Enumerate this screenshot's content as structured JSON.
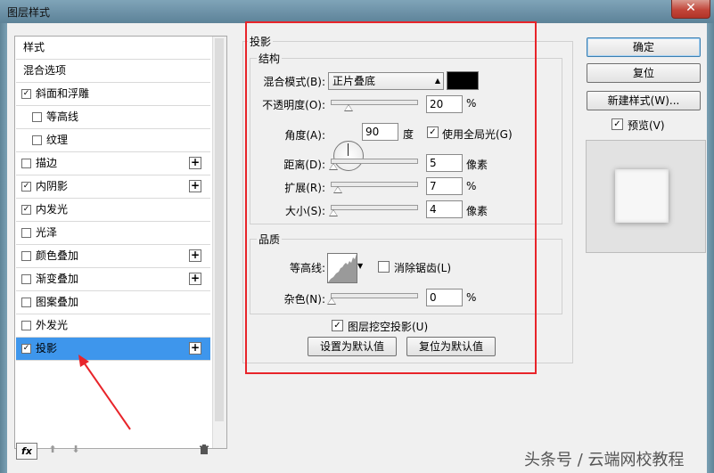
{
  "window": {
    "title": "图层样式",
    "close_glyph": "✕"
  },
  "left_panel": {
    "items": [
      {
        "label": "样式",
        "has_checkbox": false,
        "checked": false,
        "indent": false,
        "has_plus": false,
        "selected": false
      },
      {
        "label": "混合选项",
        "has_checkbox": false,
        "checked": false,
        "indent": false,
        "has_plus": false,
        "selected": false
      },
      {
        "label": "斜面和浮雕",
        "has_checkbox": true,
        "checked": true,
        "indent": false,
        "has_plus": false,
        "selected": false
      },
      {
        "label": "等高线",
        "has_checkbox": true,
        "checked": false,
        "indent": true,
        "has_plus": false,
        "selected": false
      },
      {
        "label": "纹理",
        "has_checkbox": true,
        "checked": false,
        "indent": true,
        "has_plus": false,
        "selected": false
      },
      {
        "label": "描边",
        "has_checkbox": true,
        "checked": false,
        "indent": false,
        "has_plus": true,
        "selected": false
      },
      {
        "label": "内阴影",
        "has_checkbox": true,
        "checked": true,
        "indent": false,
        "has_plus": true,
        "selected": false
      },
      {
        "label": "内发光",
        "has_checkbox": true,
        "checked": true,
        "indent": false,
        "has_plus": false,
        "selected": false
      },
      {
        "label": "光泽",
        "has_checkbox": true,
        "checked": false,
        "indent": false,
        "has_plus": false,
        "selected": false
      },
      {
        "label": "颜色叠加",
        "has_checkbox": true,
        "checked": false,
        "indent": false,
        "has_plus": true,
        "selected": false
      },
      {
        "label": "渐变叠加",
        "has_checkbox": true,
        "checked": false,
        "indent": false,
        "has_plus": true,
        "selected": false
      },
      {
        "label": "图案叠加",
        "has_checkbox": true,
        "checked": false,
        "indent": false,
        "has_plus": false,
        "selected": false
      },
      {
        "label": "外发光",
        "has_checkbox": true,
        "checked": false,
        "indent": false,
        "has_plus": false,
        "selected": false
      },
      {
        "label": "投影",
        "has_checkbox": true,
        "checked": true,
        "indent": false,
        "has_plus": true,
        "selected": true
      }
    ],
    "fx_label": "fx",
    "up_glyph": "⬆",
    "down_glyph": "⬇",
    "trash_glyph": "🗑"
  },
  "drop_shadow": {
    "section_title": "投影",
    "structure": {
      "title": "结构",
      "blend_mode_label": "混合模式(B):",
      "blend_mode_value": "正片叠底",
      "blend_color": "#000000",
      "opacity_label": "不透明度(O):",
      "opacity_value": "20",
      "opacity_unit": "%",
      "angle_label": "角度(A):",
      "angle_value": "90",
      "angle_unit": "度",
      "global_light_label": "使用全局光(G)",
      "global_light_checked": true,
      "distance_label": "距离(D):",
      "distance_value": "5",
      "distance_unit": "像素",
      "spread_label": "扩展(R):",
      "spread_value": "7",
      "spread_unit": "%",
      "size_label": "大小(S):",
      "size_value": "4",
      "size_unit": "像素"
    },
    "quality": {
      "title": "品质",
      "contour_label": "等高线:",
      "antialias_label": "消除锯齿(L)",
      "antialias_checked": false,
      "noise_label": "杂色(N):",
      "noise_value": "0",
      "noise_unit": "%"
    },
    "knockout_label": "图层挖空投影(U)",
    "knockout_checked": true,
    "set_default_label": "设置为默认值",
    "reset_default_label": "复位为默认值"
  },
  "right_buttons": {
    "ok": "确定",
    "reset": "复位",
    "new_style": "新建样式(W)...",
    "preview_label": "预览(V)",
    "preview_checked": true
  },
  "watermark": "头条号 / 云端网校教程",
  "colors": {
    "selection": "#3e96ec",
    "annotation_red": "#e8242a"
  }
}
